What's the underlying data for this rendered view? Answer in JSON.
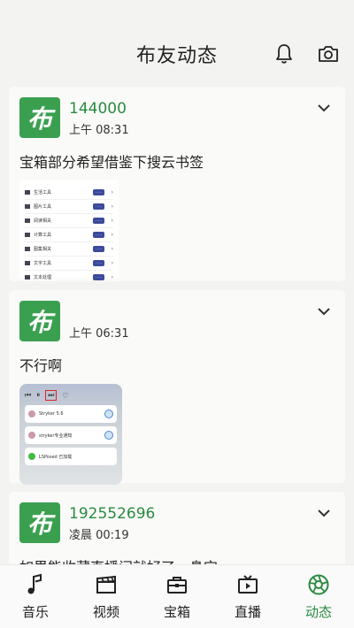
{
  "header": {
    "title": "布友动态"
  },
  "icons": {
    "bell": "bell-icon",
    "camera": "camera-icon"
  },
  "accent": "#2a8a40",
  "posts": [
    {
      "avatar_text": "布",
      "username": "144000",
      "time": "上午 08:31",
      "text": "宝箱部分希望借鉴下搜云书签",
      "image_items": [
        "生活工具",
        "图片工具",
        "阅读相关",
        "计算工具",
        "图集相关",
        "文字工具",
        "文本处理"
      ]
    },
    {
      "avatar_text": "布",
      "username": "",
      "time": "上午 06:31",
      "text": "不行啊",
      "notifications": [
        "Stryker 5.6",
        "stryker专业通知",
        "LSPosed 已加载"
      ]
    },
    {
      "avatar_text": "布",
      "username": "192552696",
      "time": "凌晨 00:19",
      "text": "如果能收藏直播间就好了，鼻宝"
    }
  ],
  "nav": [
    {
      "label": "音乐",
      "icon": "music-note-icon"
    },
    {
      "label": "视频",
      "icon": "clapperboard-icon"
    },
    {
      "label": "宝箱",
      "icon": "toolbox-icon"
    },
    {
      "label": "直播",
      "icon": "tv-icon"
    },
    {
      "label": "动态",
      "icon": "aperture-icon"
    }
  ]
}
